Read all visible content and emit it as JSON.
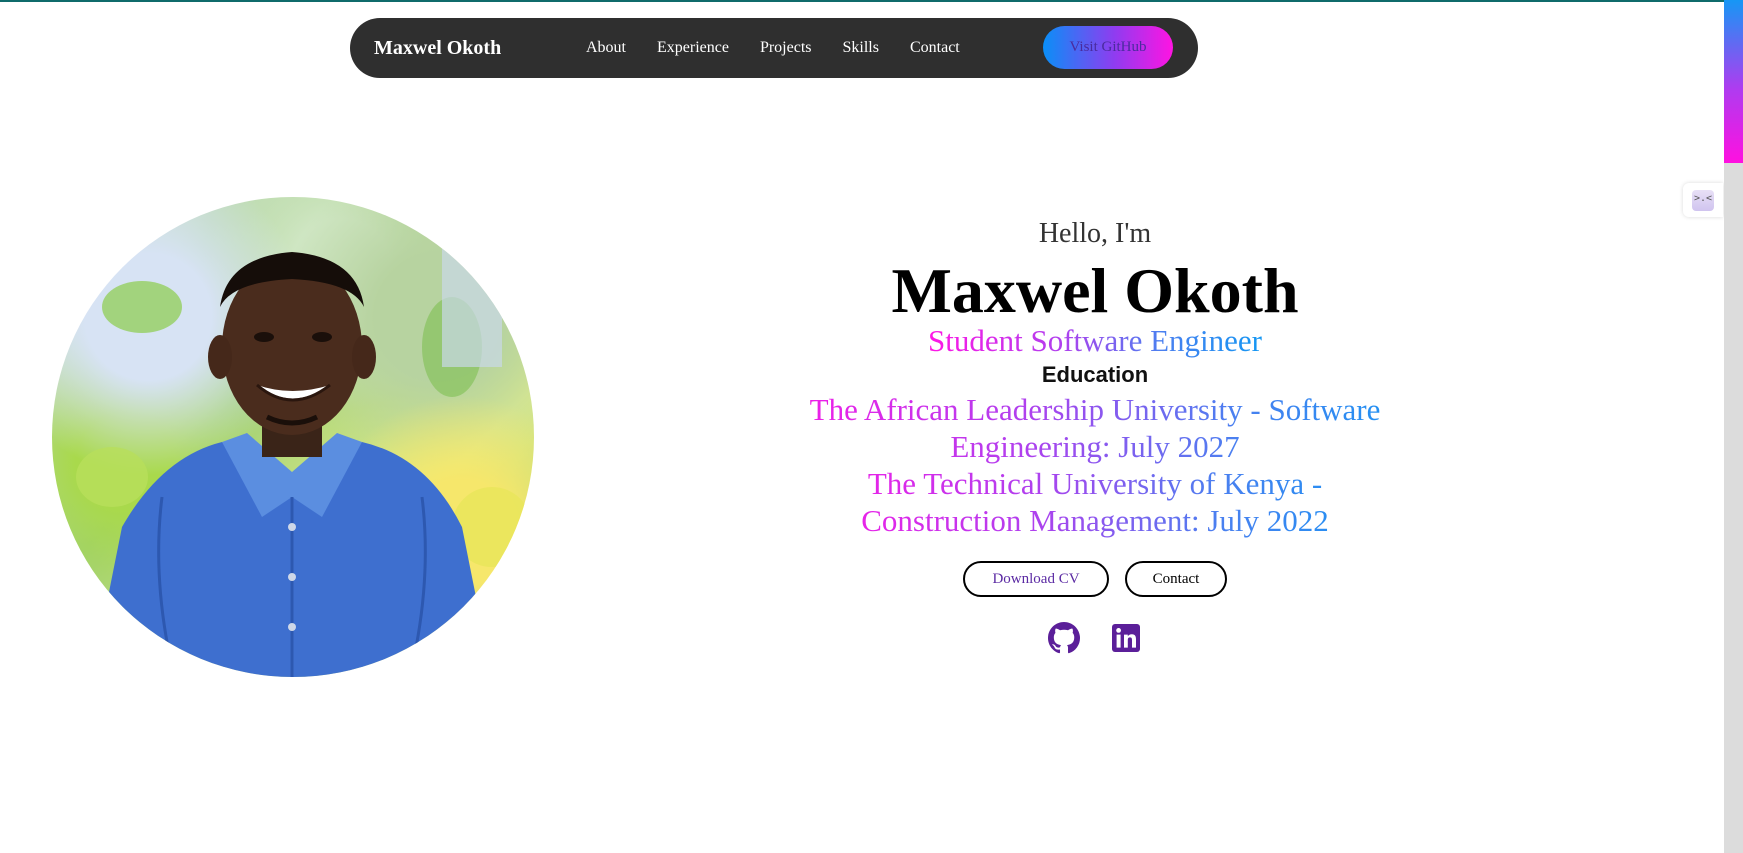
{
  "navbar": {
    "brand": "Maxwel Okoth",
    "links": [
      "About",
      "Experience",
      "Projects",
      "Skills",
      "Contact"
    ],
    "github_button": "Visit GitHub"
  },
  "hero": {
    "greeting": "Hello, I'm",
    "name": "Maxwel Okoth",
    "role": "Student Software Engineer",
    "education_title": "Education",
    "education": [
      "The African Leadership University - Software Engineering: July 2027",
      "The Technical University of Kenya - Construction Management: July 2022"
    ],
    "buttons": {
      "download_cv": "Download CV",
      "contact": "Contact"
    },
    "social": [
      "github-icon",
      "linkedin-icon"
    ]
  },
  "colors": {
    "navbar_bg": "#2f2f2f",
    "gradient_start": "#ff16e6",
    "gradient_end": "#1497f3",
    "icon_purple": "#5b1f99"
  },
  "side_widget": {
    "icon_text": ">.<"
  }
}
